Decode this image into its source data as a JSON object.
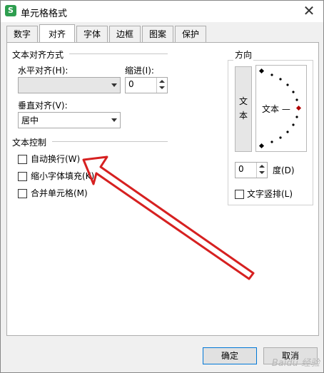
{
  "window": {
    "title": "单元格格式",
    "app_icon": "S"
  },
  "tabs": [
    {
      "label": "数字"
    },
    {
      "label": "对齐",
      "active": true
    },
    {
      "label": "字体"
    },
    {
      "label": "边框"
    },
    {
      "label": "图案"
    },
    {
      "label": "保护"
    }
  ],
  "alignment": {
    "section_title": "文本对齐方式",
    "horizontal_label": "水平对齐(H):",
    "horizontal_value": "",
    "indent_label": "缩进(I):",
    "indent_value": "0",
    "vertical_label": "垂直对齐(V):",
    "vertical_value": "居中"
  },
  "text_control": {
    "section_title": "文本控制",
    "wrap_text": {
      "label": "自动换行(W)",
      "checked": false
    },
    "shrink_to_fit": {
      "label": "缩小字体填充(K)",
      "checked": false
    },
    "merge_cells": {
      "label": "合并单元格(M)",
      "checked": false
    }
  },
  "orientation": {
    "section_title": "方向",
    "vertical_text": "文本",
    "dial_label": "文本 —",
    "degrees_value": "0",
    "degrees_label": "度(D)",
    "vertical_layout": {
      "label": "文字竖排(L)",
      "checked": false
    }
  },
  "buttons": {
    "ok": "确定",
    "cancel": "取消"
  },
  "colors": {
    "annotation_arrow": "#d62020",
    "dial_marker": "#b00000",
    "ok_border": "#0078d7"
  },
  "watermark": "Baidu 经验"
}
